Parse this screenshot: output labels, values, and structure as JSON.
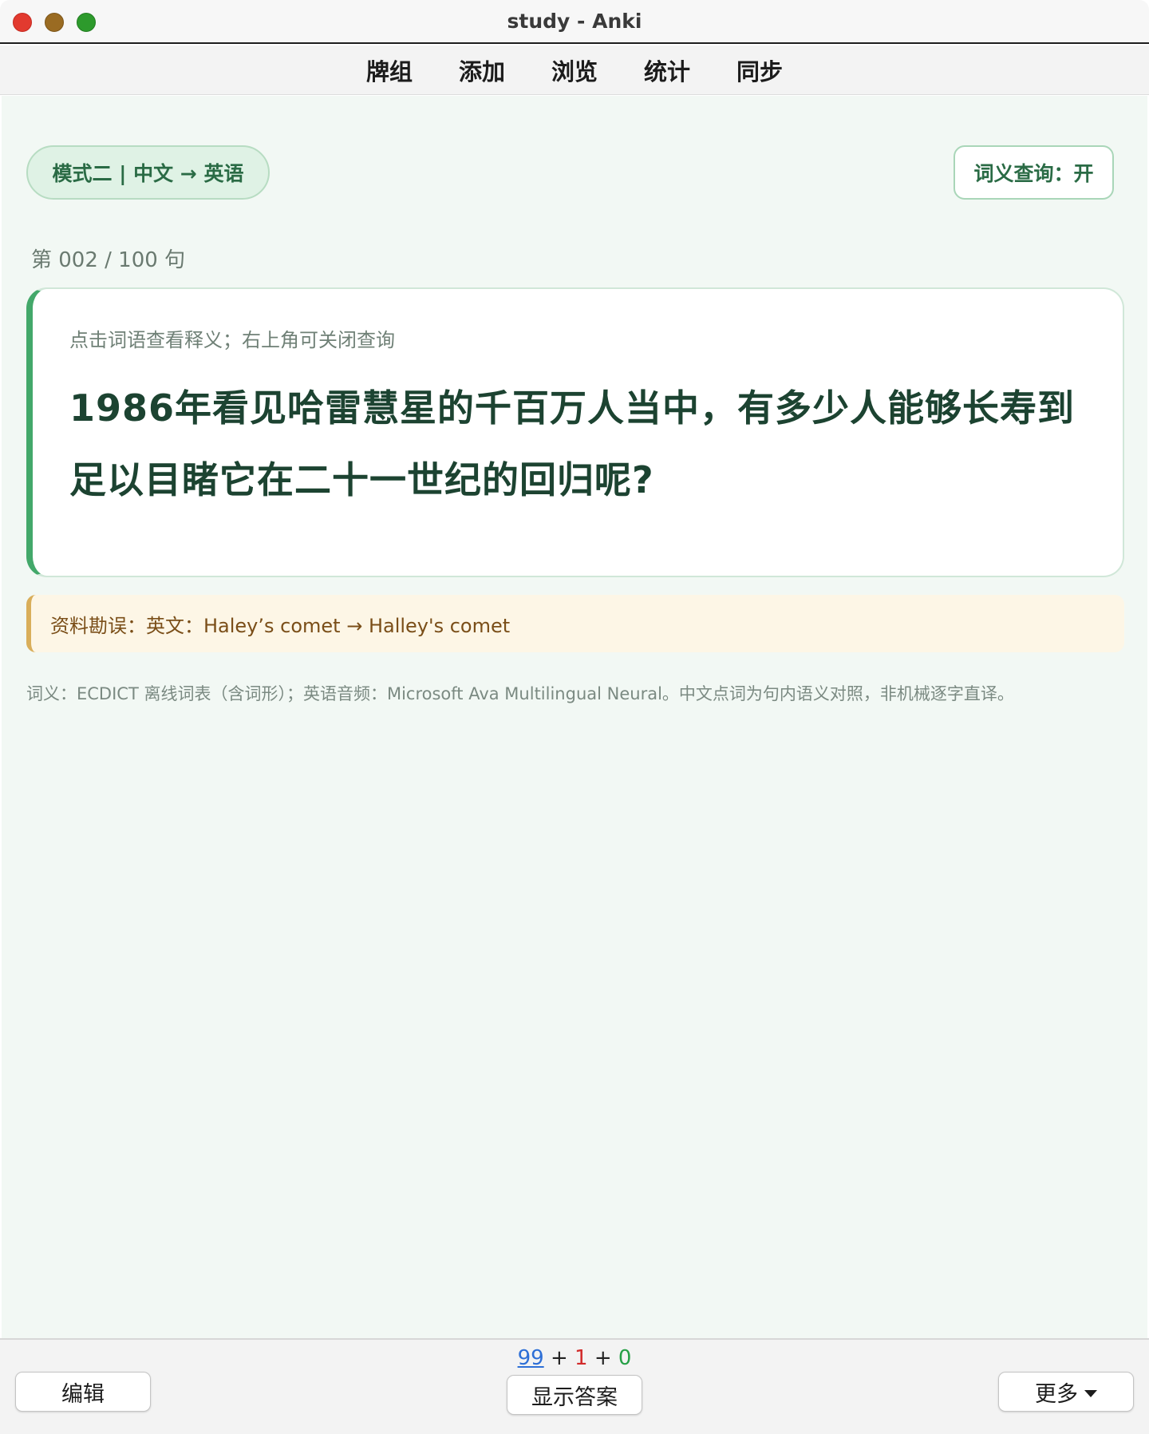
{
  "window": {
    "title": "study - Anki"
  },
  "nav": {
    "items": [
      "牌组",
      "添加",
      "浏览",
      "统计",
      "同步"
    ]
  },
  "main": {
    "mode_label": "模式二 | 中文 → 英语",
    "lookup_toggle": "词义查询：开",
    "counter": "第 002 / 100 句",
    "card": {
      "hint": "点击词语查看释义；右上角可关闭查询",
      "sentence": "1986年看见哈雷慧星的千百万人当中，有多少人能够长寿到足以目睹它在二十一世纪的回归呢?"
    },
    "erratum": "资料勘误：英文：Haley’s comet → Halley's comet",
    "footnote": "词义：ECDICT 离线词表（含词形）；英语音频：Microsoft Ava Multilingual Neural。中文点词为句内语义对照，非机械逐字直译。"
  },
  "bottom": {
    "edit_label": "编辑",
    "show_answer_label": "显示答案",
    "more_label": "更多",
    "due": {
      "new": "99",
      "plus1": "+",
      "learn": "1",
      "plus2": "+",
      "review": "0"
    }
  },
  "colors": {
    "accent_green": "#43a86a",
    "text_dark_green": "#1c4331",
    "new_blue": "#2e6fd6",
    "learn_red": "#d22b2b",
    "review_green": "#26a046"
  }
}
